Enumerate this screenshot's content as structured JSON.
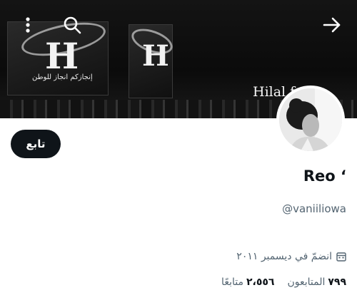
{
  "banner": {
    "caption": "Hilal f",
    "billboard_logo": "H",
    "billboard_text": "إنجازكم انجاز للوطن"
  },
  "profile": {
    "follow_label": "تابع",
    "display_name": "Reo ‘",
    "handle": "@vaniiliowa",
    "joined": "انضمّ في ديسمبر ٢٠١١",
    "following": {
      "count": "٢،٥٥٦",
      "label": "متابعًا"
    },
    "followers": {
      "count": "٧٩٩",
      "label": "المتابعون"
    }
  },
  "icons": {
    "back": "arrow-right-icon",
    "search": "search-icon",
    "more": "more-vertical-icon",
    "calendar": "calendar-icon"
  }
}
